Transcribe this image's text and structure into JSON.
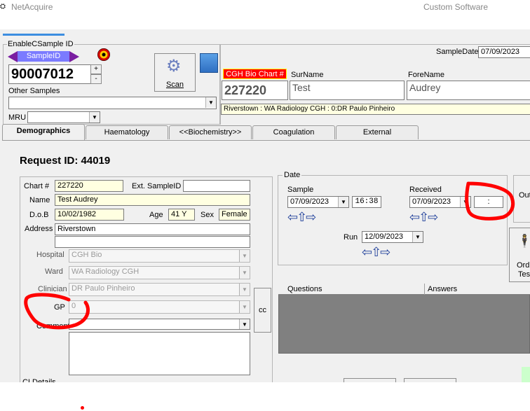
{
  "titlebar": {
    "app": "NetAcquire",
    "right": "Custom Software"
  },
  "sample": {
    "enable_label": "EnableCSample ID",
    "sampleid_label": "SampleID",
    "value": "90007012",
    "plus": "+",
    "minus": "-",
    "other_label": "Other Samples",
    "mru_label": "MRU"
  },
  "scan": {
    "label": "Scan"
  },
  "patient": {
    "sample_date_label": "SampleDate",
    "sample_date": "07/09/2023",
    "chart_badge": "CGH Bio Chart #",
    "chart": "227220",
    "surname_label": "SurName",
    "surname": "Test",
    "forename_label": "ForeName",
    "forename": "Audrey",
    "address_line": "Riverstown : WA  Radiology CGH : 0:DR Paulo Pinheiro"
  },
  "tabs": [
    "Demographics",
    "Haematology",
    "<<Biochemistry>>",
    "Coagulation",
    "External"
  ],
  "request": {
    "title": "Request ID: 44019"
  },
  "demo": {
    "chart_label": "Chart #",
    "chart": "227220",
    "ext_label": "Ext. SampleID",
    "ext": "",
    "name_label": "Name",
    "name": "Test Audrey",
    "dob_label": "D.o.B",
    "dob": "10/02/1982",
    "age_label": "Age",
    "age": "41 Y",
    "sex_label": "Sex",
    "sex": "Female",
    "address_label": "Address",
    "address1": "Riverstown",
    "address2": "",
    "hospital_label": "Hospital",
    "hospital": "CGH Bio",
    "ward_label": "Ward",
    "ward": "WA  Radiology CGH",
    "clinician_label": "Clinician",
    "clinician": "DR Paulo Pinheiro",
    "gp_label": "GP",
    "gp": "0",
    "cc_label": "cc",
    "comment_label": "Comment",
    "cldetails_label": "CLDetails"
  },
  "date": {
    "group_label": "Date",
    "sample_label": "Sample",
    "sample_date": "07/09/2023",
    "sample_time": "16:38",
    "received_label": "Received",
    "received_date": "07/09/2023",
    "received_time": ":",
    "run_label": "Run",
    "run_date": "12/09/2023"
  },
  "right": {
    "out_label": "Out",
    "order_label1": "Ord",
    "order_label2": "Tes"
  },
  "qa": {
    "questions": "Questions",
    "answers": "Answers"
  },
  "colors": {
    "annotation": "#ff0000",
    "badge": "#ff0000",
    "sampleid": "#7b7bff"
  }
}
